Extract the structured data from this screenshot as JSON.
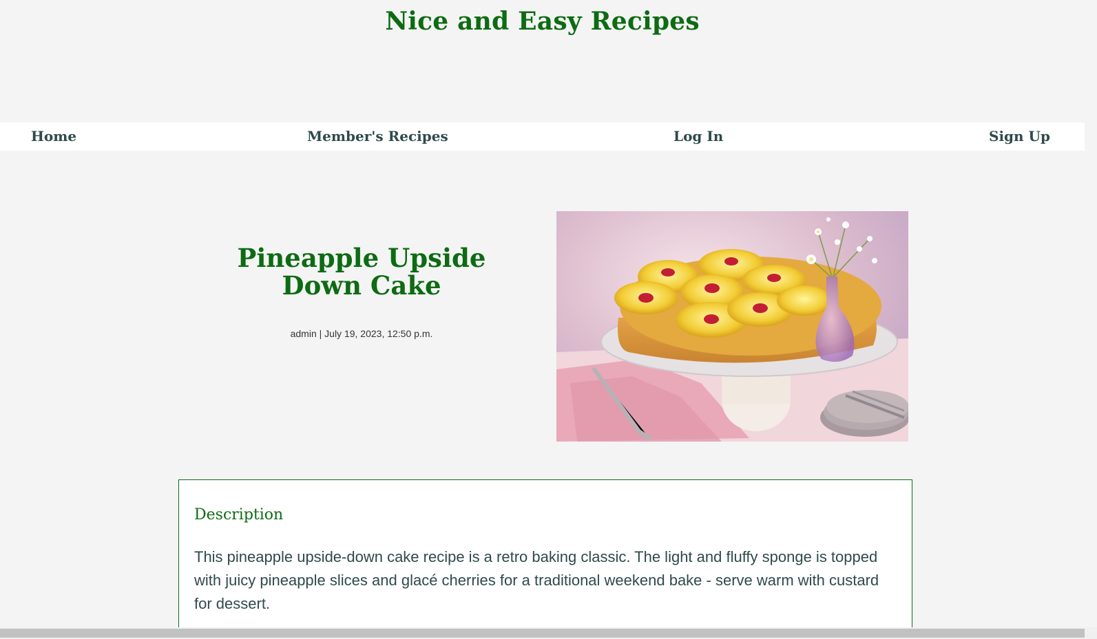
{
  "site": {
    "title": "Nice and Easy Recipes"
  },
  "nav": {
    "home": "Home",
    "members_recipes": "Member's Recipes",
    "login": "Log In",
    "signup": "Sign Up"
  },
  "recipe": {
    "title": "Pineapple Upside Down Cake",
    "meta": "admin | July 19, 2023, 12:50 p.m.",
    "image_description": "pineapple-upside-down-cake-photo"
  },
  "description": {
    "heading": "Description",
    "text": "This pineapple upside-down cake recipe is a retro baking classic. The light and fluffy sponge is topped with juicy pineapple slices and glacé cherries for a traditional weekend bake - serve warm with custard for dessert."
  },
  "colors": {
    "brand_green": "#0d6b12",
    "nav_text": "#2f4a4a",
    "page_background": "#f4f4f4"
  }
}
